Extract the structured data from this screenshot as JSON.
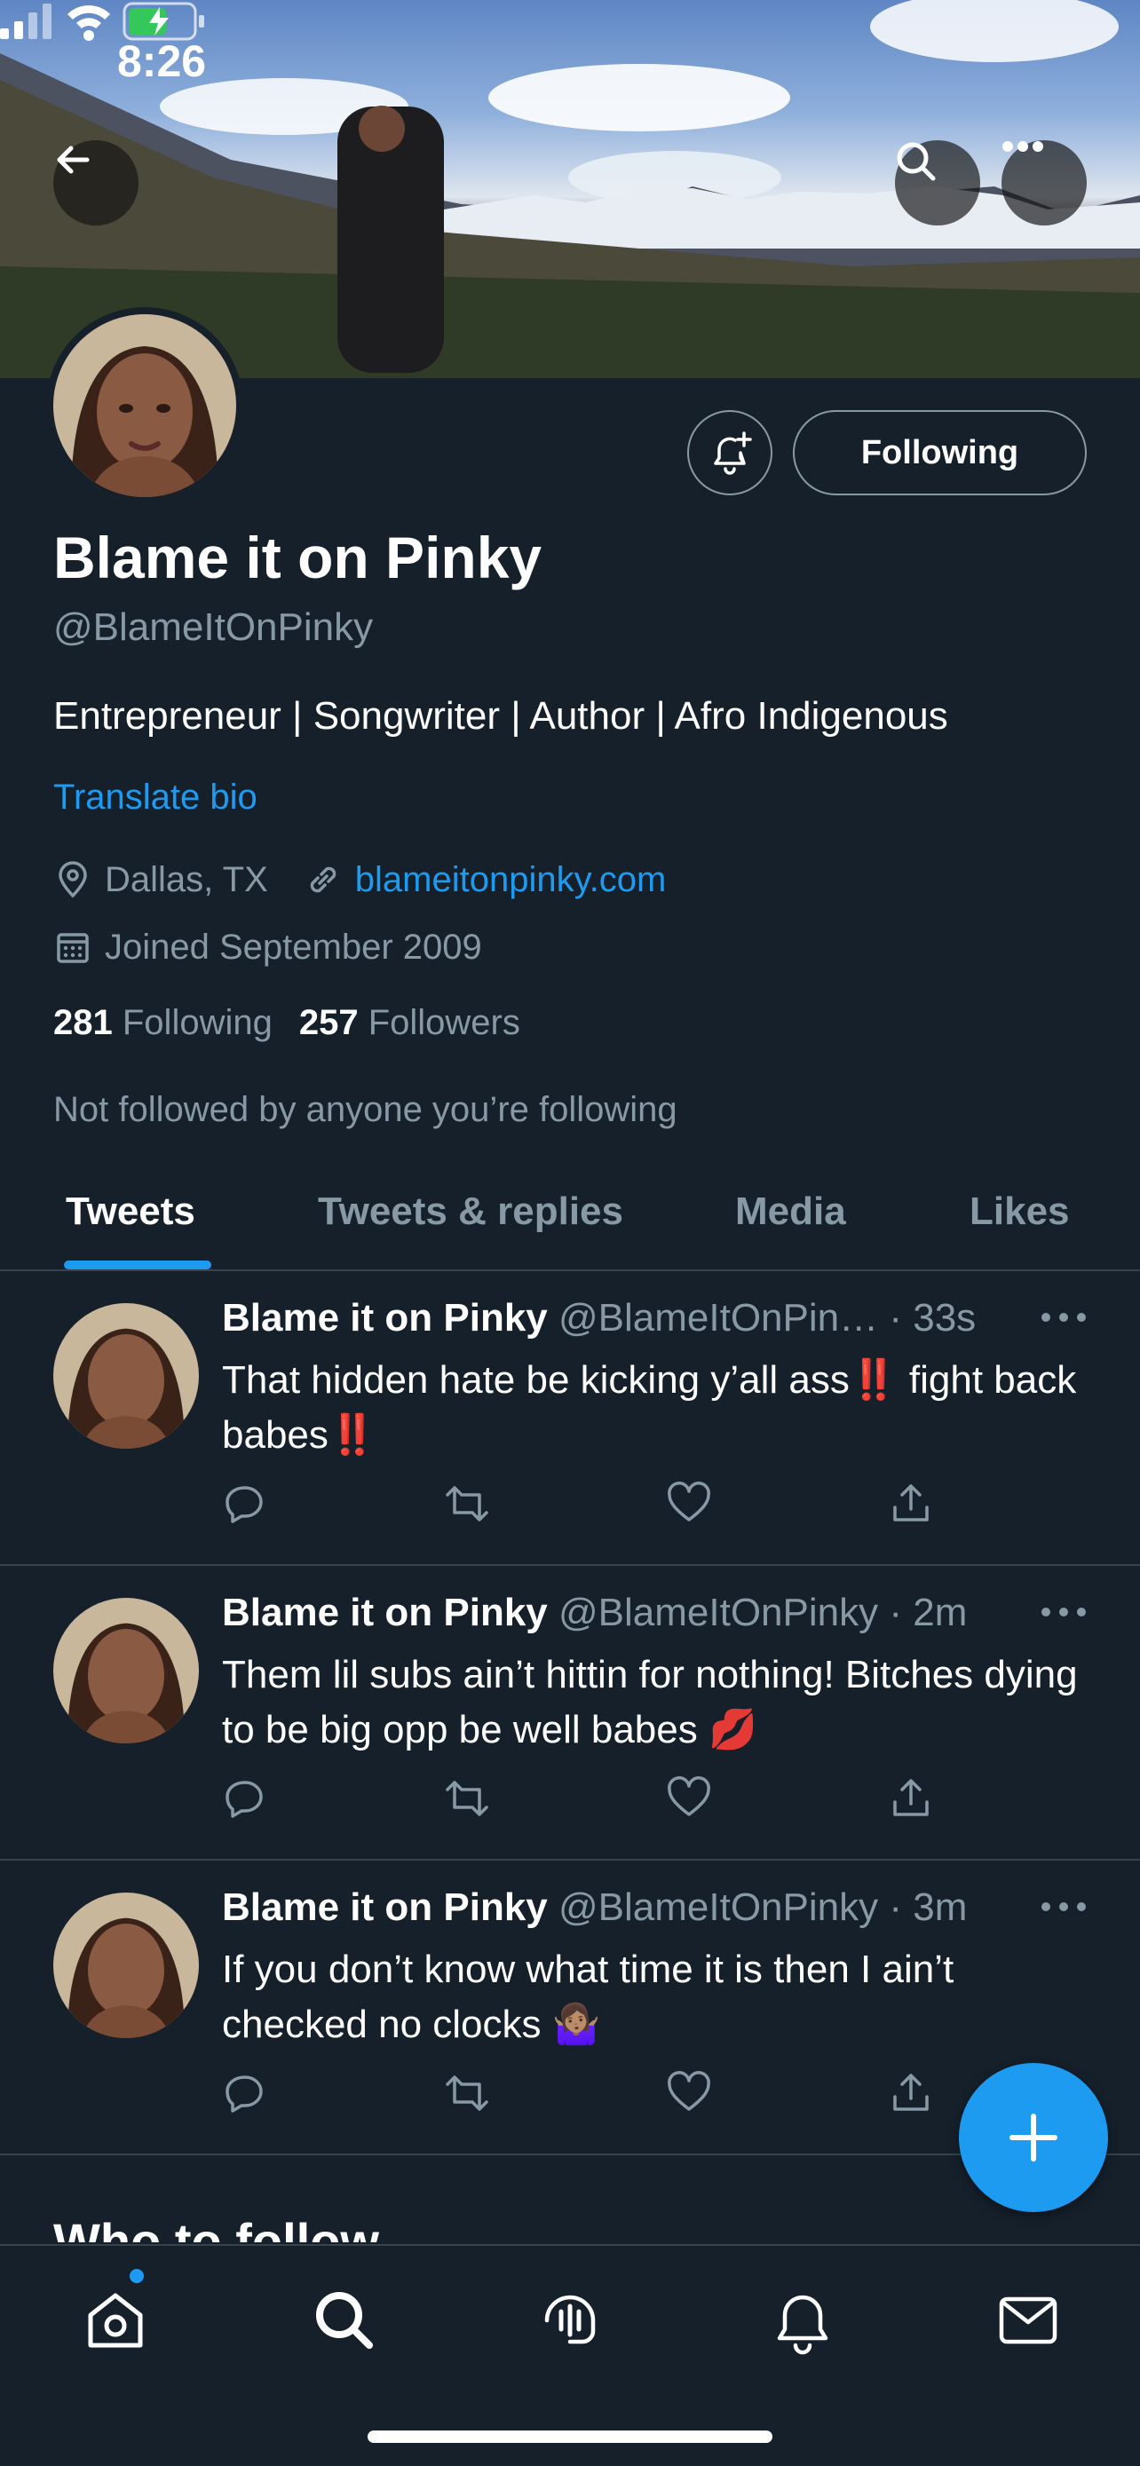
{
  "status_bar": {
    "time": "8:26"
  },
  "profile": {
    "display_name": "Blame it on Pinky",
    "handle": "@BlameItOnPinky",
    "bio": "Entrepreneur | Songwriter | Author | Afro Indigenous",
    "translate_label": "Translate bio",
    "location": "Dallas, TX",
    "website": "blameitonpinky.com",
    "joined": "Joined September 2009",
    "following_count": "281",
    "following_label": "Following",
    "followers_count": "257",
    "followers_label": "Followers",
    "not_followed_note": "Not followed by anyone you’re following",
    "follow_button_label": "Following"
  },
  "tabs": [
    {
      "label": "Tweets",
      "active": true
    },
    {
      "label": "Tweets & replies",
      "active": false
    },
    {
      "label": "Media",
      "active": false
    },
    {
      "label": "Likes",
      "active": false
    }
  ],
  "tweets": [
    {
      "name": "Blame it on Pinky",
      "handle_time": "@BlameItOnPin… · 33s",
      "text_a": "That hidden hate be kicking y’all ass",
      "emoji_a": "‼️",
      "text_b": " fight back babes",
      "emoji_b": "‼️"
    },
    {
      "name": "Blame it on Pinky",
      "handle_time": "@BlameItOnPinky · 2m",
      "text_a": "Them lil subs ain’t hittin for nothing! Bitches dying to be big opp be well babes ",
      "emoji_a": "💋"
    },
    {
      "name": "Blame it on Pinky",
      "handle_time": "@BlameItOnPinky · 3m",
      "text_a": "If you don’t know what time it is then I ain’t checked no clocks ",
      "emoji_a": "🤷🏽‍♀️"
    }
  ],
  "section_heading": "Who to follow",
  "icons": {
    "back": "arrow-left-icon",
    "search": "search-icon",
    "more": "more-horizontal-icon",
    "bell": "bell-plus-icon",
    "location": "location-pin-icon",
    "link": "link-icon",
    "calendar": "calendar-icon",
    "reply": "reply-icon",
    "retweet": "retweet-icon",
    "like": "heart-icon",
    "share": "share-icon",
    "compose": "plus-icon",
    "nav": [
      "home-icon",
      "search-icon",
      "spaces-icon",
      "notifications-icon",
      "messages-icon"
    ]
  },
  "colors": {
    "background": "#15202b",
    "accent": "#1d9bf0",
    "secondary_text": "#8899a6",
    "divider": "#38444d"
  }
}
